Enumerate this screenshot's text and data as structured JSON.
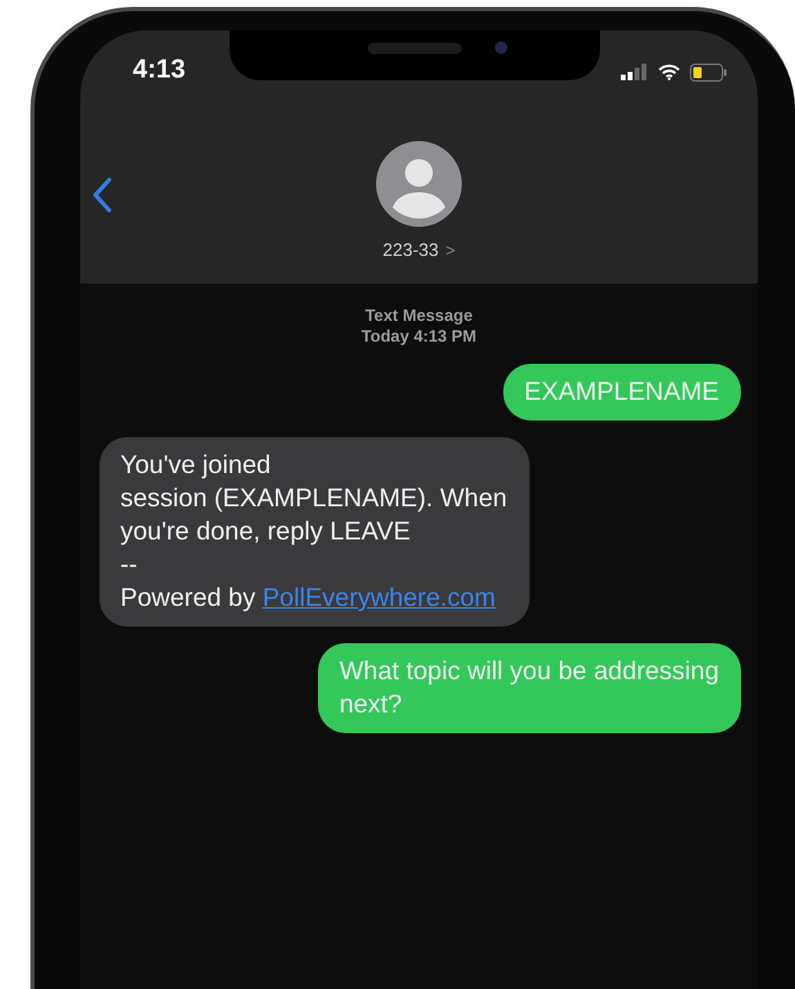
{
  "status_bar": {
    "time": "4:13"
  },
  "header": {
    "contact": "223-33",
    "chevron": ">"
  },
  "thread_info": {
    "service": "Text Message",
    "timestamp": "Today 4:13 PM"
  },
  "messages": [
    {
      "kind": "sent",
      "text": "EXAMPLENAME"
    },
    {
      "kind": "received",
      "text": "You've joined\nsession (EXAMPLENAME). When\nyou're done, reply LEAVE\n--\nPowered by ",
      "link": "PollEverywhere.com"
    },
    {
      "kind": "sent",
      "text": "What topic will you be addressing\nnext?"
    }
  ]
}
